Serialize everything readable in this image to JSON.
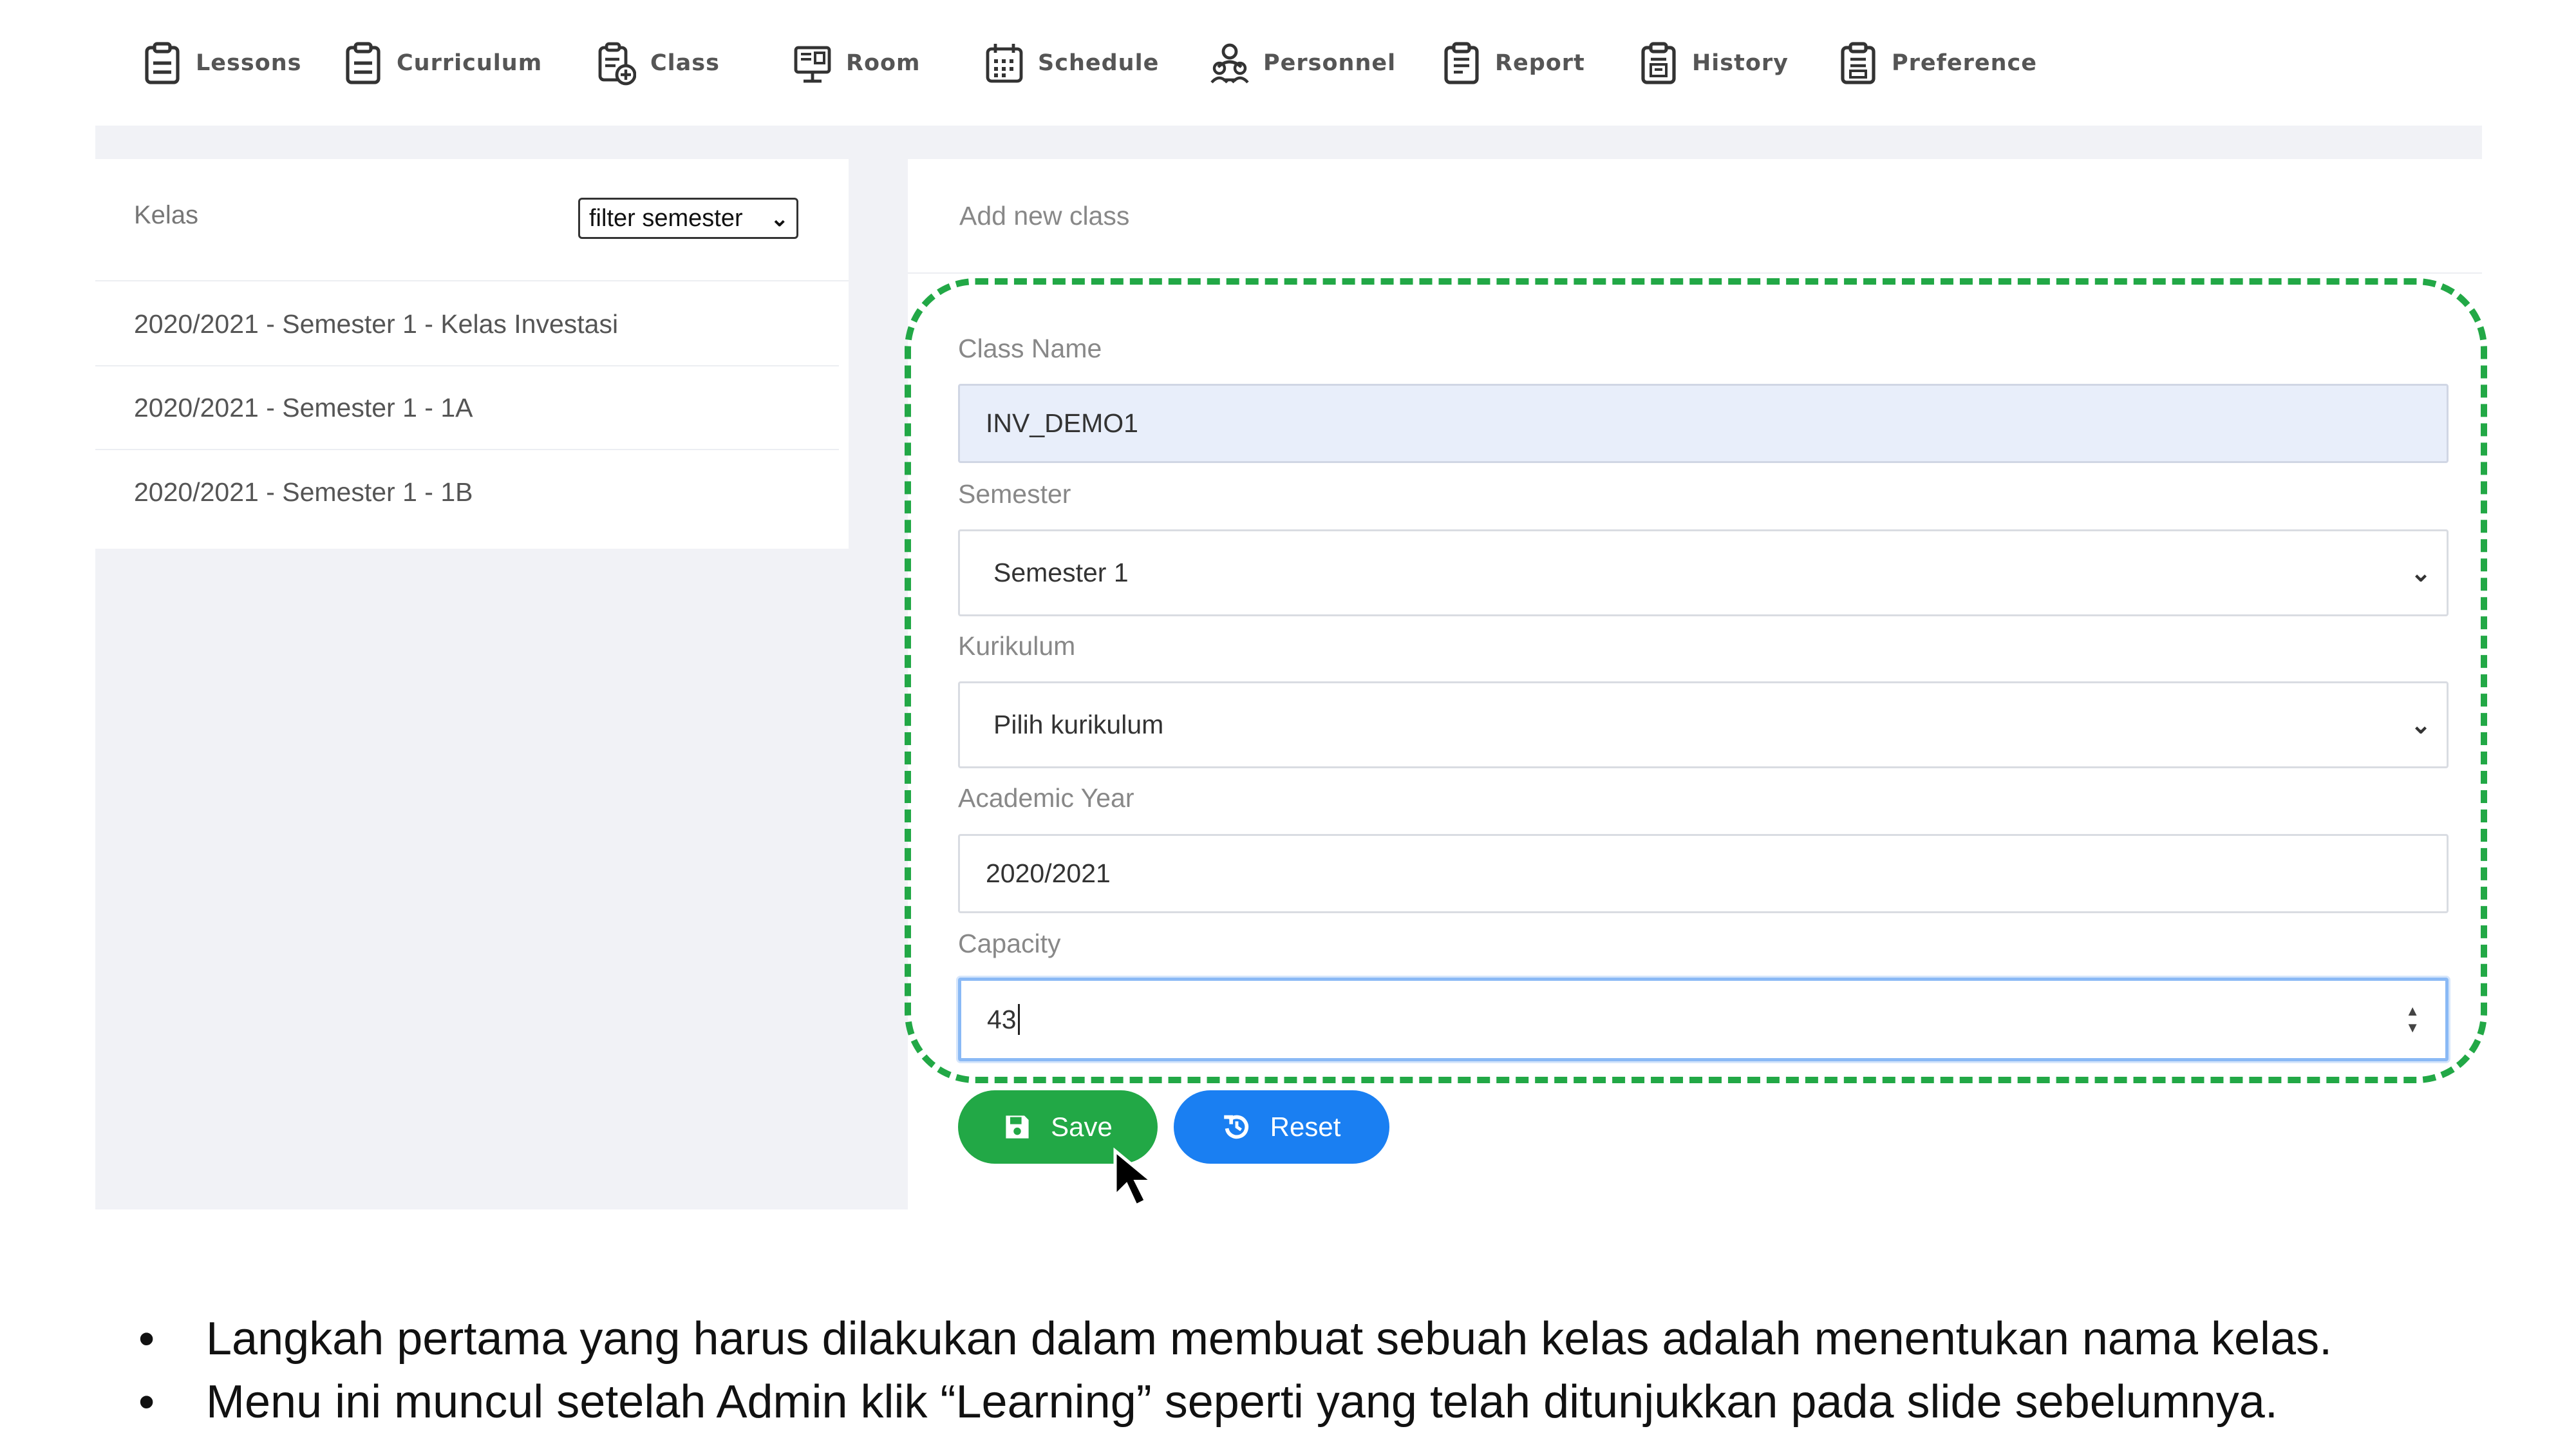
{
  "nav": {
    "items": [
      {
        "label": "Lessons",
        "icon": "clipboard-icon"
      },
      {
        "label": "Curriculum",
        "icon": "clipboard-icon"
      },
      {
        "label": "Class",
        "icon": "clipboard-add-icon"
      },
      {
        "label": "Room",
        "icon": "monitor-icon"
      },
      {
        "label": "Schedule",
        "icon": "calendar-icon"
      },
      {
        "label": "Personnel",
        "icon": "people-icon"
      },
      {
        "label": "Report",
        "icon": "report-icon"
      },
      {
        "label": "History",
        "icon": "history-icon"
      },
      {
        "label": "Preference",
        "icon": "preference-icon"
      }
    ]
  },
  "left_panel": {
    "title": "Kelas",
    "filter": "filter semester",
    "classes": [
      "2020/2021 - Semester 1 - Kelas Investasi",
      "2020/2021 - Semester 1 - 1A",
      "2020/2021 - Semester 1 - 1B"
    ]
  },
  "form": {
    "title": "Add new class",
    "class_name_label": "Class Name",
    "class_name_value": "INV_DEMO1",
    "semester_label": "Semester",
    "semester_value": "Semester 1",
    "kurikulum_label": "Kurikulum",
    "kurikulum_value": "Pilih kurikulum",
    "academic_year_label": "Academic Year",
    "academic_year_value": "2020/2021",
    "capacity_label": "Capacity",
    "capacity_value": "43",
    "save_label": "Save",
    "reset_label": "Reset"
  },
  "colors": {
    "highlight_dash": "#22a846",
    "save_button": "#22a846",
    "reset_button": "#1a7ff2"
  },
  "notes": [
    "Langkah pertama yang harus dilakukan dalam membuat sebuah kelas adalah menentukan nama kelas.",
    "Menu ini muncul setelah Admin klik “Learning” seperti yang telah ditunjukkan pada slide sebelumnya."
  ]
}
